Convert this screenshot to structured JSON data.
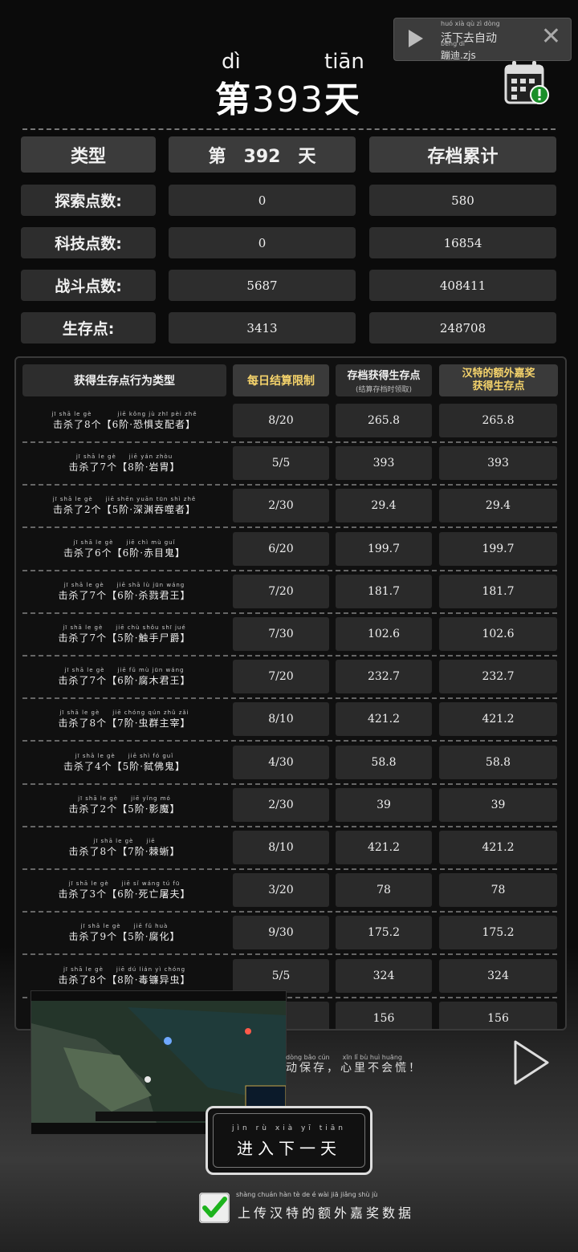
{
  "title": {
    "prefix_char": "第",
    "prefix_pinyin": "dì",
    "day_number": "393",
    "suffix_char": "天",
    "suffix_pinyin": "tiān"
  },
  "banner": {
    "line1": "活下去自动",
    "line1_pinyin": "huó xià qù zì dòng",
    "line2": "蹦迪.zjs",
    "line2_pinyin": "bèng dí"
  },
  "summary": {
    "headers": [
      "类型",
      "第　392　天",
      "存档累计"
    ],
    "rows": [
      {
        "label": "探索点数:",
        "day": "0",
        "total": "580"
      },
      {
        "label": "科技点数:",
        "day": "0",
        "total": "16854"
      },
      {
        "label": "战斗点数:",
        "day": "5687",
        "total": "408411"
      },
      {
        "label": "生存点:",
        "day": "3413",
        "total": "248708"
      }
    ]
  },
  "table": {
    "headers": {
      "type": "获得生存点行为类型",
      "limit": "每日结算限制",
      "archive": "存档获得生存点",
      "archive_sub": "(结算存档时领取)",
      "bonus_line1": "汉特的额外嘉奖",
      "bonus_line2": "获得生存点"
    },
    "rows": [
      {
        "pinyin": "jī shā le gè　　　　jiē kǒng jù zhī pèi zhě",
        "name": "击杀了8个【6阶·恐惧支配者】",
        "limit": "8/20",
        "archive": "265.8",
        "bonus": "265.8"
      },
      {
        "pinyin": "jī shā le gè　　jiē yán zhòu",
        "name": "击杀了7个【8阶·岩胄】",
        "limit": "5/5",
        "archive": "393",
        "bonus": "393"
      },
      {
        "pinyin": "jī shā le gè　　jiē shēn yuān tūn shì zhě",
        "name": "击杀了2个【5阶·深渊吞噬者】",
        "limit": "2/30",
        "archive": "29.4",
        "bonus": "29.4"
      },
      {
        "pinyin": "jī shā le gè　　jiē chì mù guǐ",
        "name": "击杀了6个【6阶·赤目鬼】",
        "limit": "6/20",
        "archive": "199.7",
        "bonus": "199.7"
      },
      {
        "pinyin": "jī shā le gè　　jiē shā lù jūn wáng",
        "name": "击杀了7个【6阶·杀戮君王】",
        "limit": "7/20",
        "archive": "181.7",
        "bonus": "181.7"
      },
      {
        "pinyin": "jī shā le gè　　jiē chù shǒu shī jué",
        "name": "击杀了7个【5阶·触手尸爵】",
        "limit": "7/30",
        "archive": "102.6",
        "bonus": "102.6"
      },
      {
        "pinyin": "jī shā le gè　　jiē fǔ mù jūn wáng",
        "name": "击杀了7个【6阶·腐木君王】",
        "limit": "7/20",
        "archive": "232.7",
        "bonus": "232.7"
      },
      {
        "pinyin": "jī shā le gè　　jiē chóng qún zhǔ zǎi",
        "name": "击杀了8个【7阶·虫群主宰】",
        "limit": "8/10",
        "archive": "421.2",
        "bonus": "421.2"
      },
      {
        "pinyin": "jī shā le gè　　jiē shì fó guǐ",
        "name": "击杀了4个【5阶·弑佛鬼】",
        "limit": "4/30",
        "archive": "58.8",
        "bonus": "58.8"
      },
      {
        "pinyin": "jī shā le gè　　jiē yǐng mó",
        "name": "击杀了2个【5阶·影魔】",
        "limit": "2/30",
        "archive": "39",
        "bonus": "39"
      },
      {
        "pinyin": "jī shā le gè　　jiē",
        "name": "击杀了8个【7阶·棘蜥】",
        "limit": "8/10",
        "archive": "421.2",
        "bonus": "421.2"
      },
      {
        "pinyin": "jī shā le gè　　jiē sǐ wáng tú fū",
        "name": "击杀了3个【6阶·死亡屠夫】",
        "limit": "3/20",
        "archive": "78",
        "bonus": "78"
      },
      {
        "pinyin": "jī shā le gè　　jiē fǔ huà",
        "name": "击杀了9个【5阶·腐化】",
        "limit": "9/30",
        "archive": "175.2",
        "bonus": "175.2"
      },
      {
        "pinyin": "jī shā le gè　　jiē dú lián yì chóng",
        "name": "击杀了8个【8阶·毒镰异虫】",
        "limit": "5/5",
        "archive": "324",
        "bonus": "324"
      },
      {
        "pinyin": "",
        "name": "",
        "limit": "0",
        "archive": "156",
        "bonus": "156"
      }
    ]
  },
  "tip": {
    "pinyin": "dòng bǎo cún　　xīn lǐ bù huì huāng",
    "text": "动保存，心里不会慌！"
  },
  "next_button": {
    "pinyin": "jìn rù xià yī tiān",
    "label": "进入下一天"
  },
  "upload": {
    "pinyin": "shàng chuán hàn tè de é wài jiā jiǎng shù jù",
    "label": "上传汉特的额外嘉奖数据",
    "checked": true
  },
  "colors": {
    "background": "#0b0b0b",
    "cell": "#2d2d2d",
    "header_highlight": "#f5d36b",
    "check_green": "#1db31d"
  }
}
